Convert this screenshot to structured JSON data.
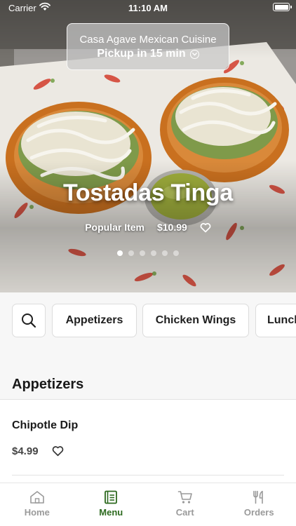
{
  "status_bar": {
    "carrier": "Carrier",
    "time": "11:10 AM",
    "icons": [
      "wifi-icon",
      "battery-icon"
    ]
  },
  "header": {
    "restaurant_name": "Casa Agave Mexican Cuisine",
    "pickup_label": "Pickup in 15 min",
    "pickup_icon": "chevron-down-circle-icon"
  },
  "featured": {
    "title": "Tostadas Tinga",
    "badge": "Popular Item",
    "price": "$10.99",
    "favorite_icon": "heart-outline-icon",
    "carousel_count": 6,
    "carousel_active_index": 0
  },
  "categories": {
    "search_icon": "search-icon",
    "items": [
      "Appetizers",
      "Chicken Wings",
      "Lunch"
    ]
  },
  "section": {
    "title": "Appetizers"
  },
  "menu_items": [
    {
      "name": "Chipotle Dip",
      "price": "$4.99",
      "favorite_icon": "heart-outline-icon"
    }
  ],
  "tabbar": {
    "tabs": [
      {
        "label": "Home",
        "icon": "home-icon",
        "active": false
      },
      {
        "label": "Menu",
        "icon": "menu-book-icon",
        "active": true
      },
      {
        "label": "Cart",
        "icon": "cart-icon",
        "active": false
      },
      {
        "label": "Orders",
        "icon": "utensils-icon",
        "active": false
      }
    ]
  },
  "colors": {
    "accent": "#2d6a1f",
    "inactive_tab": "#9a9a9a",
    "background": "#f7f7f7"
  }
}
